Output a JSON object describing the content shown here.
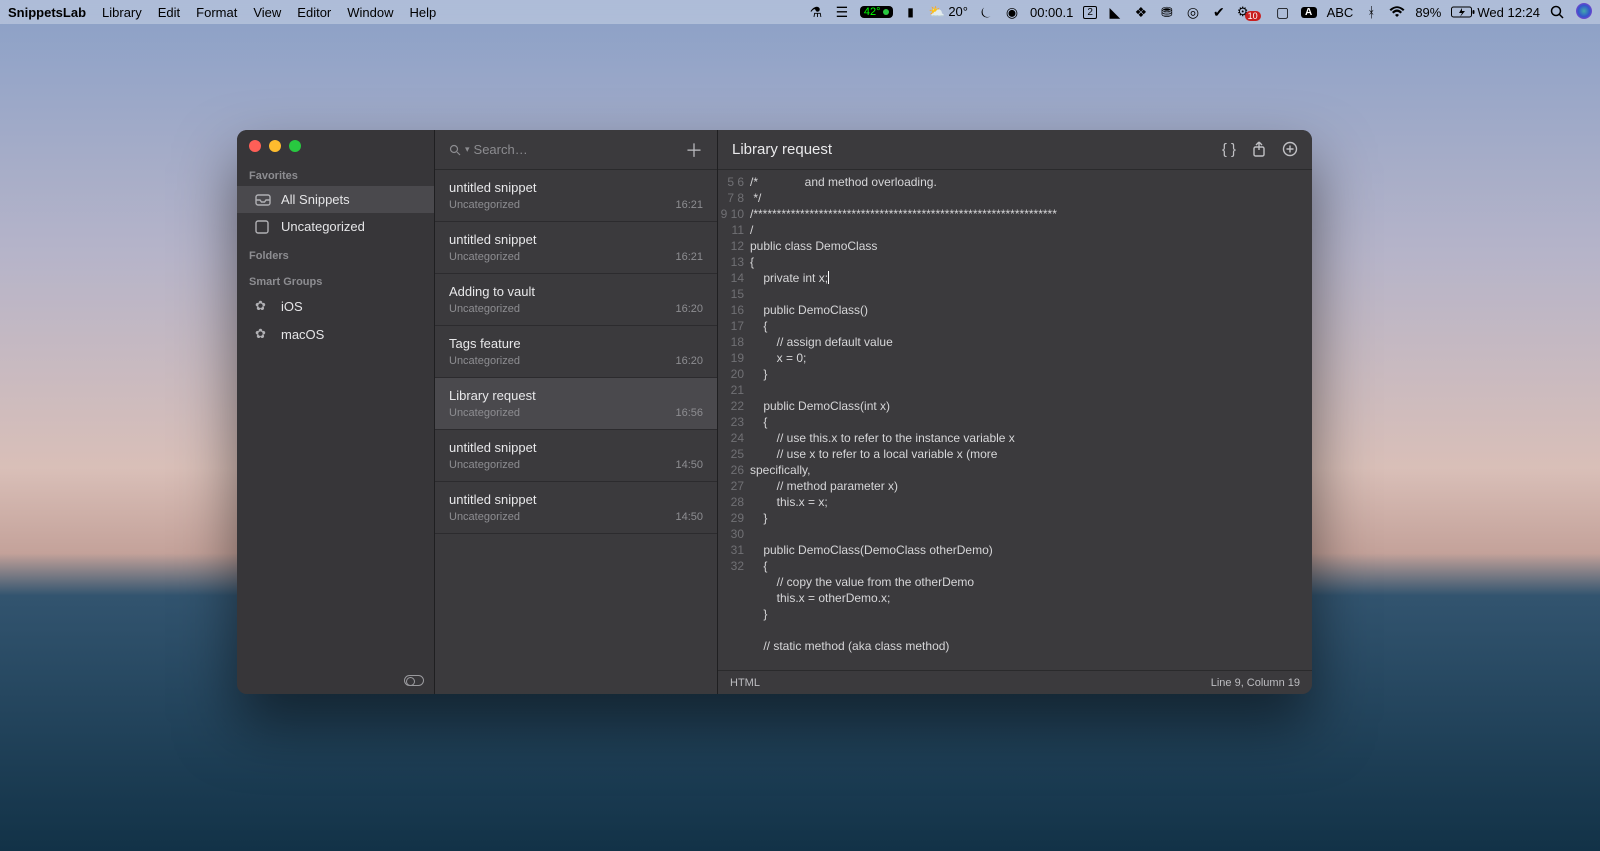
{
  "menubar": {
    "app": "SnippetsLab",
    "menus": [
      "Library",
      "Edit",
      "Format",
      "View",
      "Editor",
      "Window",
      "Help"
    ],
    "temp_badge": "42°",
    "weather": "20°",
    "timer": "00:00.1",
    "space": "2",
    "notif_count": "10",
    "input_label": "ABC",
    "battery_pct": "89%",
    "clock": "Wed 12:24",
    "input_A": "A"
  },
  "sidebar": {
    "sections": {
      "favorites": "Favorites",
      "folders": "Folders",
      "smart": "Smart Groups"
    },
    "favorites": [
      {
        "label": "All Snippets",
        "selected": true
      },
      {
        "label": "Uncategorized",
        "selected": false
      }
    ],
    "smart_groups": [
      "iOS",
      "macOS"
    ]
  },
  "search": {
    "placeholder": "Search…"
  },
  "snippets": [
    {
      "title": "untitled snippet",
      "category": "Uncategorized",
      "time": "16:21",
      "selected": false
    },
    {
      "title": "untitled snippet",
      "category": "Uncategorized",
      "time": "16:21",
      "selected": false
    },
    {
      "title": "Adding to vault",
      "category": "Uncategorized",
      "time": "16:20",
      "selected": false
    },
    {
      "title": "Tags feature",
      "category": "Uncategorized",
      "time": "16:20",
      "selected": false
    },
    {
      "title": "Library request",
      "category": "Uncategorized",
      "time": "16:56",
      "selected": true
    },
    {
      "title": "untitled snippet",
      "category": "Uncategorized",
      "time": "14:50",
      "selected": false
    },
    {
      "title": "untitled snippet",
      "category": "Uncategorized",
      "time": "14:50",
      "selected": false
    }
  ],
  "editor": {
    "title": "Library request",
    "language": "HTML",
    "position": "Line 9, Column 19",
    "gutter_start": 5,
    "code_lines": [
      "/*              and method overloading.",
      " */",
      "/*****************************************************************/",
      "public class DemoClass",
      "{",
      "    private int x;",
      "",
      "    public DemoClass()",
      "    {",
      "        // assign default value",
      "        x = 0;",
      "    }",
      "",
      "    public DemoClass(int x)",
      "    {",
      "        // use this.x to refer to the instance variable x",
      "        // use x to refer to a local variable x (more specifically,",
      "        // method parameter x)",
      "        this.x = x;",
      "    }",
      "",
      "    public DemoClass(DemoClass otherDemo)",
      "    {",
      "        // copy the value from the otherDemo",
      "        this.x = otherDemo.x;",
      "    }",
      "",
      "    // static method (aka class method)"
    ],
    "cursor_line_index": 5
  }
}
